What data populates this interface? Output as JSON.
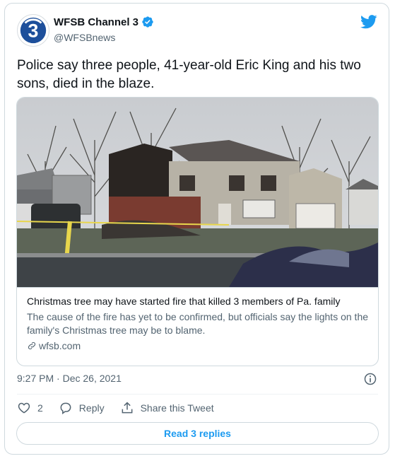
{
  "author": {
    "name": "WFSB Channel 3",
    "handle": "@WFSBnews",
    "verified": true,
    "avatar_icon": "wfsb-3-logo-icon"
  },
  "tweet": {
    "text": "Police say three people, 41-year-old Eric King and his two sons, died in the blaze."
  },
  "card": {
    "image_icon": "house-fire-photo",
    "title": "Christmas tree may have started fire that killed 3 members of Pa. family",
    "description": "The cause of the fire has yet to be confirmed, but officials say the lights on the family's Christmas tree may be to blame.",
    "domain": "wfsb.com"
  },
  "timestamp": "9:27 PM · Dec 26, 2021",
  "actions": {
    "like_count": "2",
    "reply_label": "Reply",
    "share_label": "Share this Tweet"
  },
  "read_replies_label": "Read 3 replies",
  "colors": {
    "accent": "#1d9bf0",
    "text": "#0f1419",
    "secondary": "#536471",
    "border": "#cfd9de",
    "logo_blue": "#1d4f9b"
  }
}
